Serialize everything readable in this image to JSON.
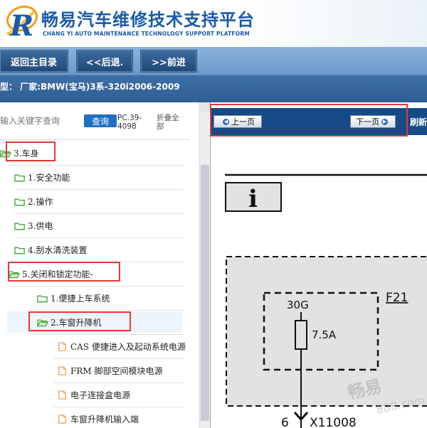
{
  "header": {
    "title": "畅易汽车维修技术支持平台",
    "subtitle": "CHANG YI AUTO MAINTENANCE TECHNOLOGY SUPPORT PLATFORM",
    "logo_letter": "R"
  },
  "nav": {
    "home_label": "返回主目录",
    "back_label": "<<后退.",
    "forward_label": ">>前进"
  },
  "vehicle": {
    "model_line": "车型：  厂家:BMW(宝马)3系-320i2006-2009"
  },
  "search": {
    "placeholder": "输入关键字查询",
    "button_label": "查询",
    "pc_code": "PC.39-4098",
    "collapse_label": "折叠全部"
  },
  "tree": {
    "items": [
      {
        "label": "3.车身",
        "icon": "folder-open-icon"
      },
      {
        "label": "1.安全功能",
        "icon": "folder-icon"
      },
      {
        "label": "2.操作",
        "icon": "folder-icon"
      },
      {
        "label": "3.供电",
        "icon": "folder-icon"
      },
      {
        "label": "4.刮水清洗装置",
        "icon": "folder-icon"
      },
      {
        "label": "5.关闭和锁定功能-",
        "icon": "folder-open-icon"
      },
      {
        "label": "1.便捷上车系统",
        "icon": "folder-icon"
      },
      {
        "label": "2.车窗升降机",
        "icon": "folder-open-icon"
      },
      {
        "label": "CAS 便捷进入及起动系统电源",
        "icon": "document-icon"
      },
      {
        "label": "FRM 脚部空间模块电源",
        "icon": "document-icon"
      },
      {
        "label": "电子连接盒电源",
        "icon": "document-icon"
      },
      {
        "label": "车窗升降机输入端",
        "icon": "document-icon"
      }
    ]
  },
  "pager": {
    "prev_label": "上一页",
    "next_label": "下一页",
    "refresh_label": "刷新"
  },
  "diagram": {
    "info_symbol": "i",
    "fuse_block": "F21",
    "terminal": "30G",
    "fuse_rating": "7.5A",
    "pin_number": "6",
    "connector": "X11008"
  },
  "watermark": {
    "text": "畅易",
    "sub": "888.com"
  },
  "colors": {
    "brand_blue": "#1a5aa8",
    "nav_button": "#1f4878",
    "highlight": "#e53935",
    "folder_green": "#3aa335"
  }
}
